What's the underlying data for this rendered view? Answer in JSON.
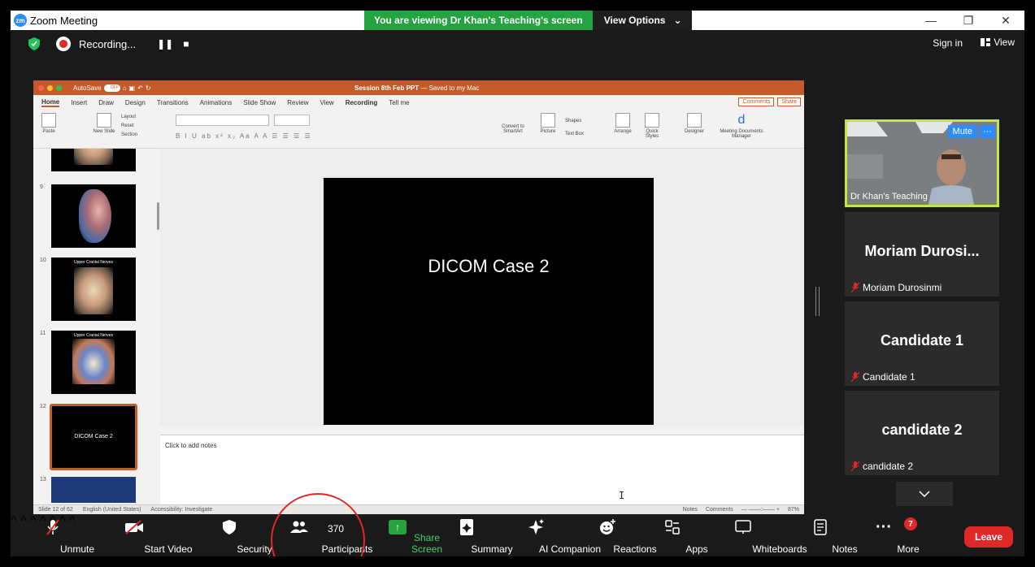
{
  "window": {
    "title": "Zoom Meeting",
    "logo": "zm",
    "share_banner": "You are viewing Dr Khan's Teaching's screen",
    "view_options": "View Options",
    "controls": {
      "minimize": "—",
      "restore": "❐",
      "close": "✕"
    }
  },
  "topbar": {
    "recording": "Recording...",
    "pause": "❚❚",
    "stop": "■",
    "sign_in": "Sign in",
    "view": "View"
  },
  "ppt": {
    "autosave": "AutoSave",
    "autosave_state": "OFF",
    "doc_title": "Session 8th Feb PPT",
    "doc_suffix": "— Saved to my Mac",
    "menu": [
      "Home",
      "Insert",
      "Draw",
      "Design",
      "Transitions",
      "Animations",
      "Slide Show",
      "Review",
      "View",
      "Recording",
      "Tell me"
    ],
    "comments": "Comments",
    "share": "Share",
    "ribbon": {
      "paste": "Paste",
      "new_slide": "New Slide",
      "layout": "Layout",
      "reset": "Reset",
      "section": "Section",
      "convert": "Convert to SmartArt",
      "picture": "Picture",
      "shapes": "Shapes",
      "text_box": "Text Box",
      "arrange": "Arrange",
      "quick_styles": "Quick Styles",
      "designer": "Designer",
      "meeting_docs": "Meeting Documents Manager"
    },
    "thumbnails": [
      {
        "num": "9",
        "title": ""
      },
      {
        "num": "10",
        "title": "Upper Cranial Nerves"
      },
      {
        "num": "11",
        "title": "Upper Cranial Nerves"
      },
      {
        "num": "12",
        "title": "DICOM Case 2"
      },
      {
        "num": "13",
        "title": ""
      }
    ],
    "slide_title": "DICOM Case 2",
    "notes_placeholder": "Click to add notes",
    "status": {
      "slide": "Slide 12 of 62",
      "language": "English (United States)",
      "accessibility": "Accessibility: Investigate",
      "notes": "Notes",
      "comments": "Comments",
      "zoom": "87%"
    }
  },
  "gallery": {
    "video_name": "Dr Khan's Teaching",
    "mute": "Mute",
    "more": "···",
    "tiles": [
      {
        "big": "Moriam  Durosi...",
        "small": "Moriam Durosinmi"
      },
      {
        "big": "Candidate 1",
        "small": "Candidate 1"
      },
      {
        "big": "candidate 2",
        "small": "candidate 2"
      }
    ]
  },
  "toolbar": {
    "unmute": "Unmute",
    "start_video": "Start Video",
    "security": "Security",
    "participants": "Participants",
    "participants_count": "370",
    "share_screen": "Share Screen",
    "summary": "Summary",
    "ai_companion": "AI Companion",
    "reactions": "Reactions",
    "apps": "Apps",
    "whiteboards": "Whiteboards",
    "notes": "Notes",
    "more": "More",
    "more_badge": "7",
    "leave": "Leave"
  },
  "colors": {
    "zoom_blue": "#2d8cff",
    "share_green": "#24a340",
    "leave_red": "#e02828",
    "ppt_orange": "#c55a2b",
    "active_speaker": "#c5e542"
  }
}
